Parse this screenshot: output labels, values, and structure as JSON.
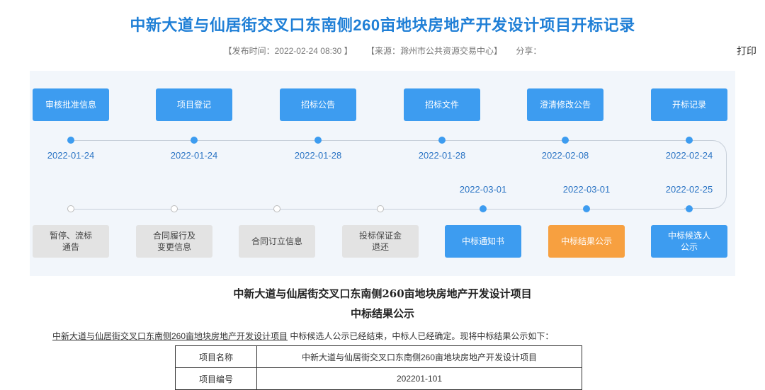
{
  "header": {
    "title": "中新大道与仙居街交叉口东南侧260亩地块房地产开发设计项目开标记录",
    "publish_time": "【发布时间：2022-02-24 08:30 】",
    "source": "【来源：滁州市公共资源交易中心】",
    "share": "分享：",
    "print": "打印"
  },
  "flow": {
    "top_steps": [
      {
        "label": "审核批准信息",
        "date": "2022-01-24"
      },
      {
        "label": "项目登记",
        "date": "2022-01-24"
      },
      {
        "label": "招标公告",
        "date": "2022-01-28"
      },
      {
        "label": "招标文件",
        "date": "2022-01-28"
      },
      {
        "label": "澄清修改公告",
        "date": "2022-02-08"
      },
      {
        "label": "开标记录",
        "date": "2022-02-24"
      }
    ],
    "bottom_steps": [
      {
        "label": "暂停、流标\n通告",
        "date": ""
      },
      {
        "label": "合同履行及\n变更信息",
        "date": ""
      },
      {
        "label": "合同订立信息",
        "date": ""
      },
      {
        "label": "投标保证金\n退还",
        "date": ""
      },
      {
        "label": "中标通知书",
        "date": "2022-03-01"
      },
      {
        "label": "中标结果公示",
        "date": "2022-03-01"
      },
      {
        "label": "中标候选人\n公示",
        "date": "2022-02-25"
      }
    ],
    "colors": {
      "blue": "#3d9cf0",
      "orange": "#f7a040",
      "gray": "#e3e3e3"
    }
  },
  "content": {
    "heading1": "中新大道与仙居街交叉口东南侧260亩地块房地产开发设计项目",
    "heading2": "中标结果公示",
    "para_project": "中新大道与仙居街交叉口东南侧260亩地块房地产开发设计项目",
    "para_rest": "中标候选人公示已经结束，中标人已经确定。现将中标结果公示如下：",
    "table": [
      {
        "key": "项目名称",
        "value": "中新大道与仙居街交叉口东南侧260亩地块房地产开发设计项目"
      },
      {
        "key": "项目编号",
        "value": "202201-101"
      }
    ]
  }
}
